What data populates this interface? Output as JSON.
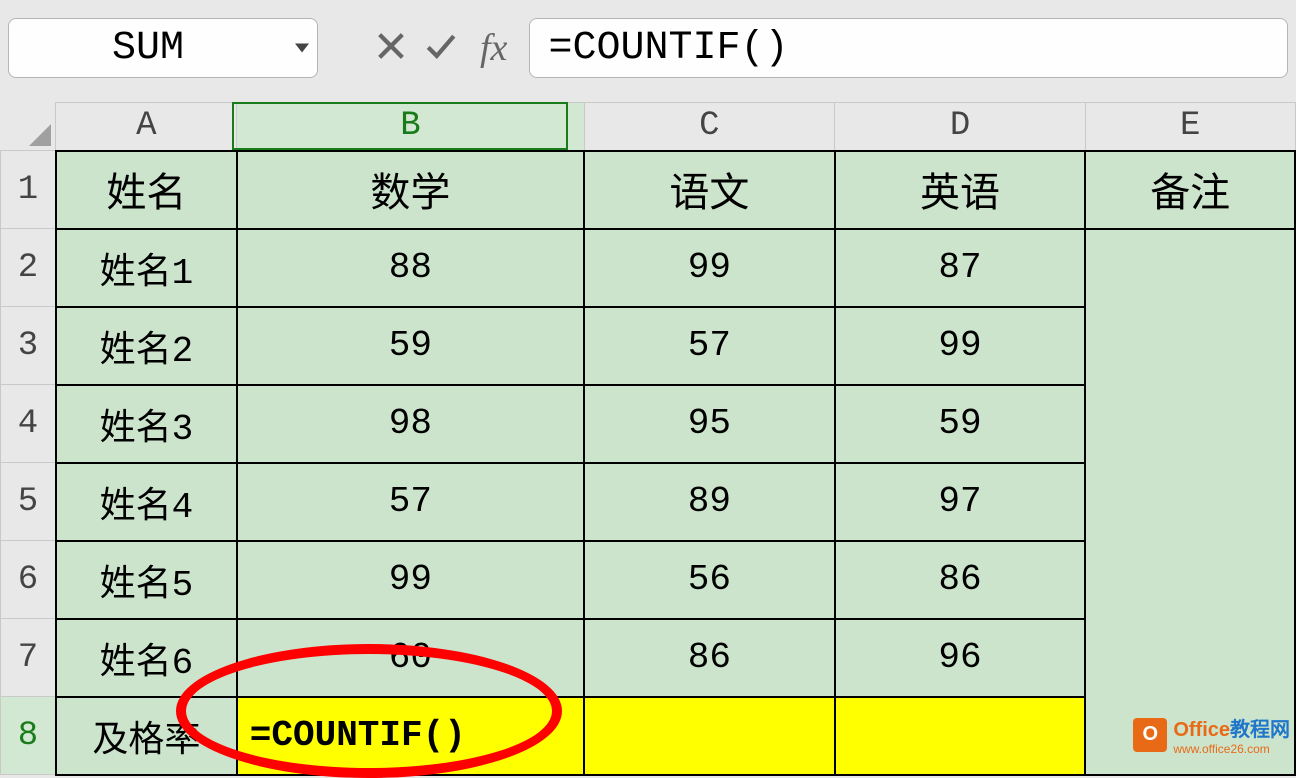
{
  "nameBox": "SUM",
  "formula": "=COUNTIF()",
  "columns": [
    "A",
    "B",
    "C",
    "D",
    "E"
  ],
  "activeColumn": "B",
  "activeRow": 8,
  "headers": {
    "A": "姓名",
    "B": "数学",
    "C": "语文",
    "D": "英语",
    "E": "备注"
  },
  "rows": [
    {
      "num": 1,
      "A": "姓名",
      "B": "数学",
      "C": "语文",
      "D": "英语",
      "E": "备注",
      "isHeaderRow": true
    },
    {
      "num": 2,
      "A": "姓名1",
      "B": "88",
      "C": "99",
      "D": "87",
      "E": ""
    },
    {
      "num": 3,
      "A": "姓名2",
      "B": "59",
      "C": "57",
      "D": "99",
      "E": ""
    },
    {
      "num": 4,
      "A": "姓名3",
      "B": "98",
      "C": "95",
      "D": "59",
      "E": ""
    },
    {
      "num": 5,
      "A": "姓名4",
      "B": "57",
      "C": "89",
      "D": "97",
      "E": ""
    },
    {
      "num": 6,
      "A": "姓名5",
      "B": "99",
      "C": "56",
      "D": "86",
      "E": ""
    },
    {
      "num": 7,
      "A": "姓名6",
      "B": "60",
      "C": "86",
      "D": "96",
      "E": ""
    },
    {
      "num": 8,
      "A": "及格率",
      "B": "=COUNTIF()",
      "C": "",
      "D": "",
      "E": "",
      "isEditing": true,
      "yellowCols": [
        "B",
        "C",
        "D"
      ]
    }
  ],
  "watermark": {
    "brand1": "Office",
    "brand2": "教程网",
    "url": "www.office26.com",
    "logoLetter": "O"
  }
}
